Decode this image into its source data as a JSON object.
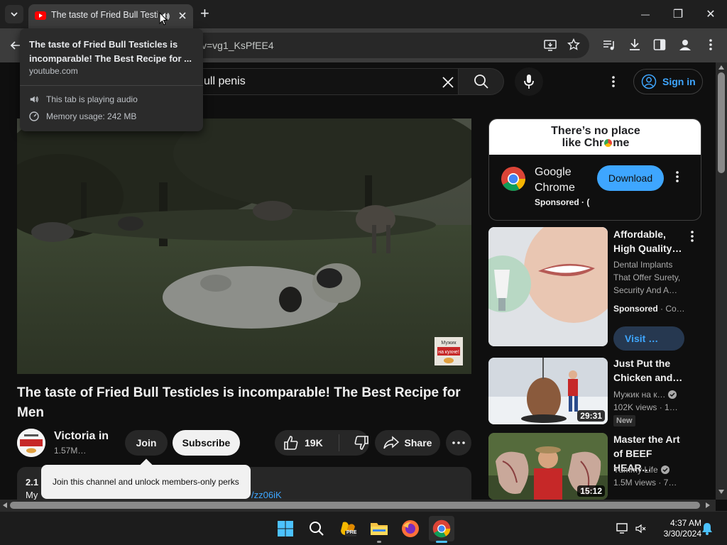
{
  "browser": {
    "tab_title": "The taste of Fried Bull Testicles is incomparable! The Best Recipe for Men",
    "url_visible": "v=vg1_KsPfEE4",
    "new_tab": "+",
    "minimize": "—",
    "maximize": "❐",
    "close": "✕"
  },
  "hovercard": {
    "title": "The taste of Fried Bull Testicles is incomparable! The Best Recipe for ...",
    "domain": "youtube.com",
    "audio": "This tab is playing audio",
    "memory": "Memory usage: 242 MB"
  },
  "youtube": {
    "search_query": "ull penis",
    "sign_in": "Sign in",
    "video_title": "The taste of Fried Bull Testicles is incomparable! The Best Recipe for Men",
    "channel_name": "Victoria in",
    "subscribers": "1.57M…",
    "join": "Join",
    "subscribe": "Subscribe",
    "likes": "19K",
    "share": "Share",
    "join_tooltip": "Join this channel and unlock members-only perks",
    "desc_views": "2.1",
    "desc_line2": "My",
    "desc_link": "/zz06iK",
    "watermark_line1": "Мужик",
    "watermark_line2": "на кухне!"
  },
  "ad": {
    "banner_line1": "There’s no place",
    "banner_line2a": "like Chr",
    "banner_line2b": "me",
    "name_line1": "Google",
    "name_line2": "Chrome",
    "sponsored": "Sponsored · (",
    "download": "Download"
  },
  "recommendations": [
    {
      "title_line1": "Affordable,",
      "title_line2": "High Quality…",
      "meta1": "Dental Implants",
      "meta2": "That Offer Surety,",
      "meta3": "Security And A…",
      "sponsored": "Sponsored",
      "sponsored_suffix": " · Co…",
      "visit": "Visit …"
    },
    {
      "title_line1": "Just Put the",
      "title_line2": "Chicken and…",
      "channel": "Мужик на к…",
      "views": "102K views · 1…",
      "badge": "New",
      "duration": "29:31"
    },
    {
      "title_line1": "Master the Art",
      "title_line2": "of BEEF HEAR…",
      "channel": "Yummy Life",
      "views": "1.5M views · 7…",
      "duration": "15:12"
    }
  ],
  "taskbar": {
    "time": "4:37 AM",
    "date": "3/30/2024",
    "pre_badge": "PRE"
  },
  "colors": {
    "youtube_red": "#ff0000",
    "link_blue": "#3ea6ff",
    "page_bg": "#0f0f0f"
  }
}
